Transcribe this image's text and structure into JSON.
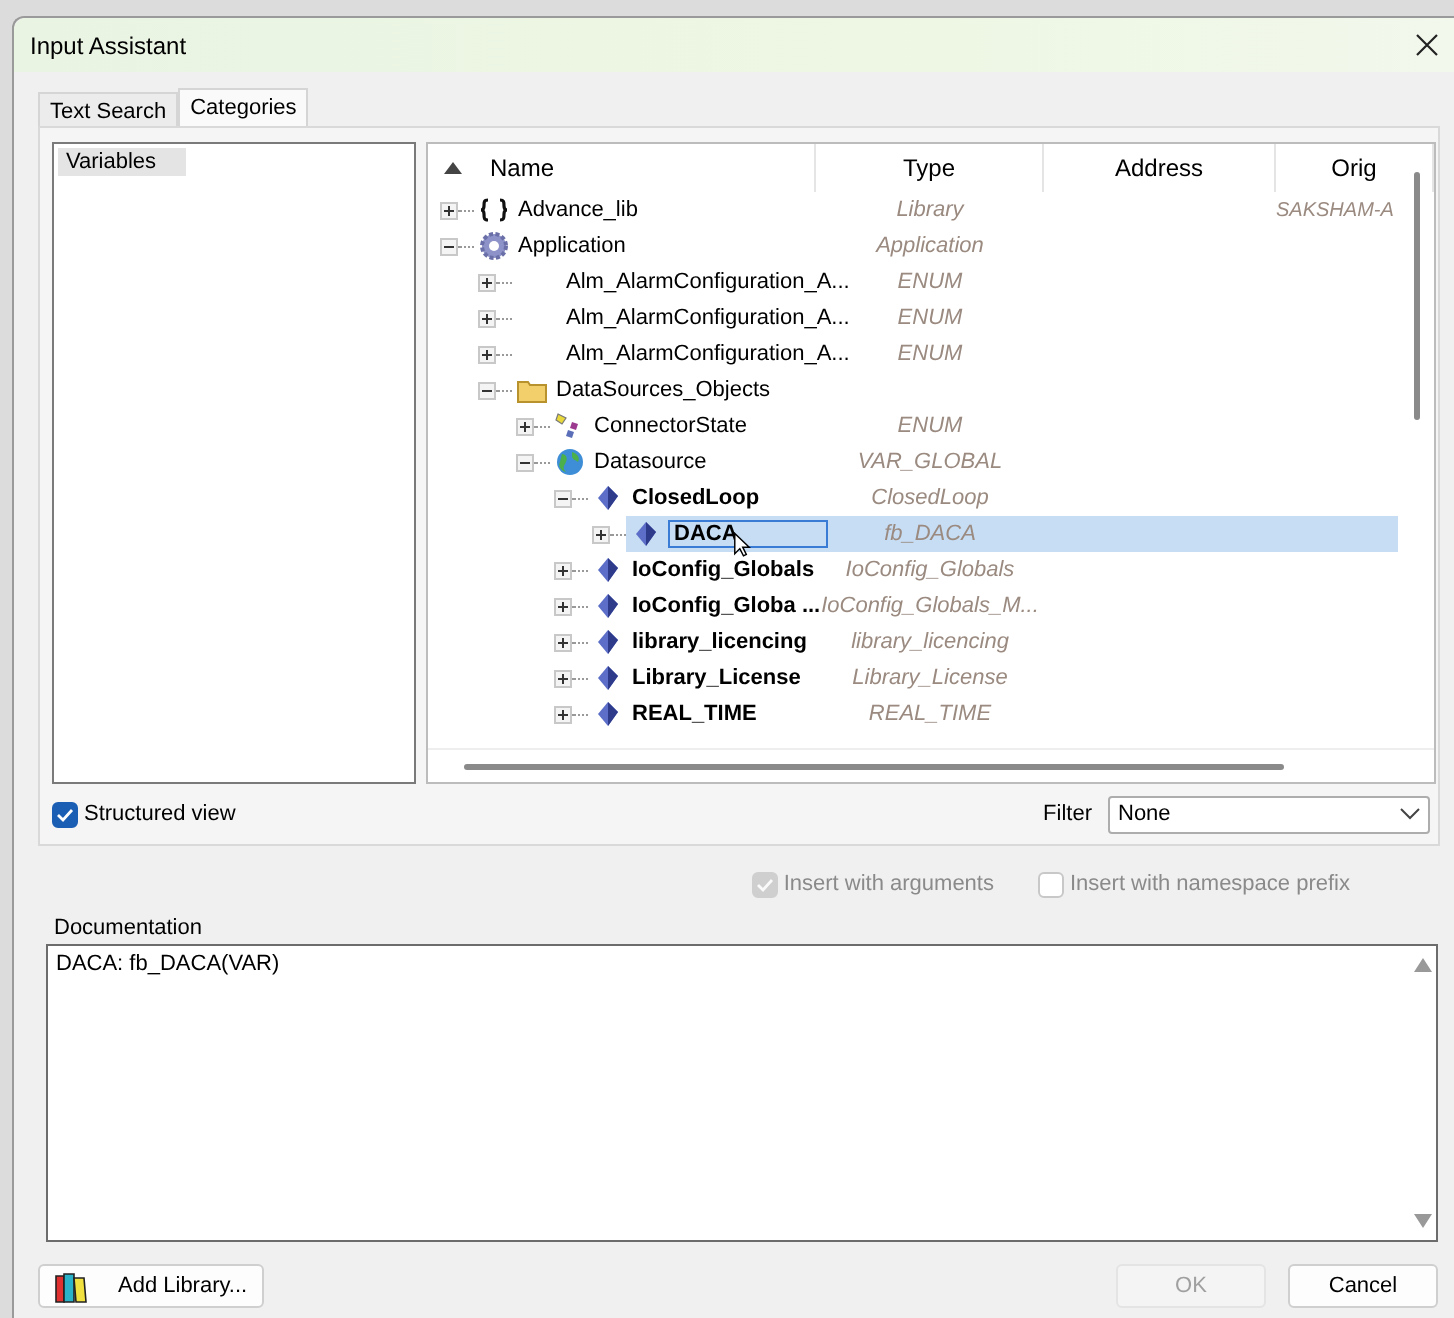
{
  "window": {
    "title": "Input Assistant"
  },
  "tabs": [
    {
      "label": "Text Search",
      "selected": false
    },
    {
      "label": "Categories",
      "selected": true
    }
  ],
  "categories": [
    {
      "label": "Variables",
      "selected": true
    }
  ],
  "tree": {
    "columns": [
      "Name",
      "Type",
      "Address",
      "Orig"
    ],
    "nodes": [
      {
        "name": "Advance_lib",
        "kind": "library",
        "type": "Library",
        "origin": "SAKSHAM-A",
        "expanded": false,
        "bold": false,
        "selected": false
      },
      {
        "name": "Application",
        "kind": "gear",
        "type": "Application",
        "expanded": true,
        "bold": false,
        "selected": false,
        "children": [
          {
            "name": "Alm_AlarmConfiguration_A...",
            "kind": "none",
            "type": "ENUM",
            "expanded": false,
            "bold": false,
            "selected": false
          },
          {
            "name": "Alm_AlarmConfiguration_A...",
            "kind": "none",
            "type": "ENUM",
            "expanded": false,
            "bold": false,
            "selected": false
          },
          {
            "name": "Alm_AlarmConfiguration_A...",
            "kind": "none",
            "type": "ENUM",
            "expanded": false,
            "bold": false,
            "selected": false
          },
          {
            "name": "DataSources_Objects",
            "kind": "folder",
            "expanded": true,
            "bold": false,
            "selected": false,
            "children": [
              {
                "name": "ConnectorState",
                "kind": "enum",
                "type": "ENUM",
                "expanded": false,
                "bold": false,
                "selected": false
              },
              {
                "name": "Datasource",
                "kind": "globe",
                "type": "VAR_GLOBAL",
                "expanded": true,
                "bold": false,
                "selected": false,
                "children": [
                  {
                    "name": "ClosedLoop",
                    "kind": "var",
                    "type": "ClosedLoop",
                    "expanded": true,
                    "bold": true,
                    "selected": false,
                    "children": [
                      {
                        "name": "DACA",
                        "kind": "var",
                        "type": "fb_DACA",
                        "expanded": false,
                        "bold": true,
                        "selected": true
                      }
                    ]
                  },
                  {
                    "name": "IoConfig_Globals",
                    "kind": "var",
                    "type": "IoConfig_Globals",
                    "expanded": false,
                    "bold": true,
                    "selected": false
                  },
                  {
                    "name": "IoConfig_Globa ...",
                    "kind": "var",
                    "type": "IoConfig_Globals_M...",
                    "expanded": false,
                    "bold": true,
                    "selected": false
                  },
                  {
                    "name": "library_licencing",
                    "kind": "var",
                    "type": "library_licencing",
                    "expanded": false,
                    "bold": true,
                    "selected": false
                  },
                  {
                    "name": "Library_License",
                    "kind": "var",
                    "type": "Library_License",
                    "expanded": false,
                    "bold": true,
                    "selected": false
                  },
                  {
                    "name": "REAL_TIME",
                    "kind": "var",
                    "type": "REAL_TIME",
                    "expanded": false,
                    "bold": true,
                    "selected": false
                  }
                ]
              }
            ]
          }
        ]
      }
    ]
  },
  "structured_view": {
    "label": "Structured view",
    "checked": true
  },
  "filter": {
    "label": "Filter",
    "value": "None"
  },
  "options": [
    {
      "label": "Insert with arguments",
      "checked": true,
      "disabled": true
    },
    {
      "label": "Insert with namespace prefix",
      "checked": false,
      "disabled": true
    }
  ],
  "documentation": {
    "label": "Documentation",
    "value": "DACA: fb_DACA(VAR)"
  },
  "buttons": [
    {
      "label": "Add Library...",
      "kind": "library",
      "disabled": false
    },
    {
      "label": "OK",
      "kind": "plain",
      "disabled": true
    },
    {
      "label": "Cancel",
      "kind": "plain",
      "disabled": false
    }
  ]
}
